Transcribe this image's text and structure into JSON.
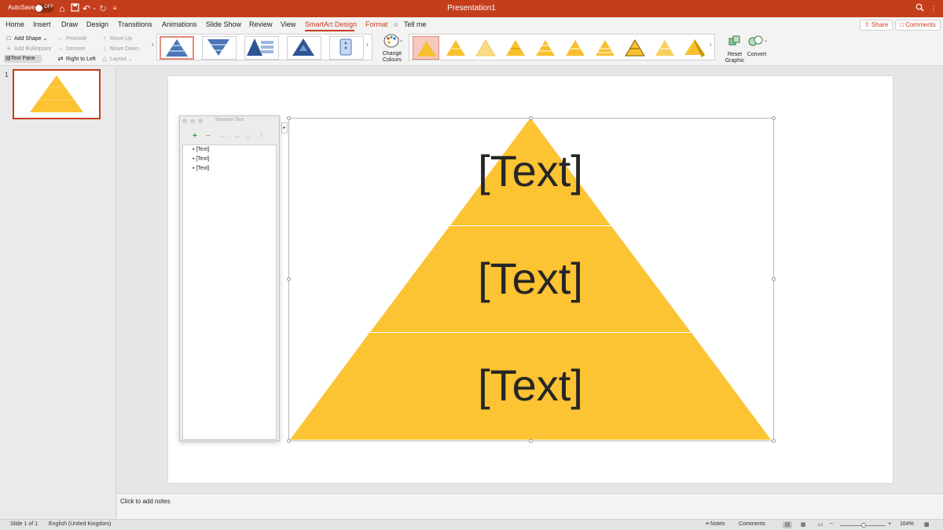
{
  "colors": {
    "accent": "#c43e1c",
    "pyramid": "#fcc332",
    "pyramid_divider": "#ffe18a"
  },
  "titlebar": {
    "autosave_label": "AutoSave",
    "autosave_state": "OFF",
    "document_title": "Presentation1",
    "icons": [
      "home-icon",
      "save-icon",
      "undo-icon",
      "redo-icon",
      "customize-icon",
      "search-icon"
    ]
  },
  "menu": {
    "tabs": [
      "Home",
      "Insert",
      "Draw",
      "Design",
      "Transitions",
      "Animations",
      "Slide Show",
      "Review",
      "View",
      "SmartArt Design",
      "Format"
    ],
    "active_tab": "SmartArt Design",
    "tell_me": "Tell me",
    "share": "Share",
    "comments": "Comments"
  },
  "ribbon": {
    "add_shape": "Add Shape",
    "add_bulletpoint": "Add Bulletpoint",
    "text_pane": "Text Pane",
    "promote": "Promote",
    "demote": "Demote",
    "right_to_left": "Right to Left",
    "move_up": "Move Up",
    "move_down": "Move Down",
    "layout": "Layout",
    "change_colours": "Change Colours",
    "reset_graphic": "Reset Graphic",
    "convert": "Convert"
  },
  "slides_pane": {
    "slide_number": "1"
  },
  "text_pane": {
    "title": "SmartArt Text",
    "items": [
      "[Text]",
      "[Text]",
      "[Text]"
    ]
  },
  "smartart": {
    "levels": [
      "[Text]",
      "[Text]",
      "[Text]"
    ]
  },
  "notes": {
    "placeholder": "Click to add notes"
  },
  "status": {
    "slide_indicator": "Slide 1 of 1",
    "language": "English (United Kingdom)",
    "notes": "Notes",
    "comments": "Comments",
    "zoom": "164%",
    "zoom_level": 0.52
  }
}
